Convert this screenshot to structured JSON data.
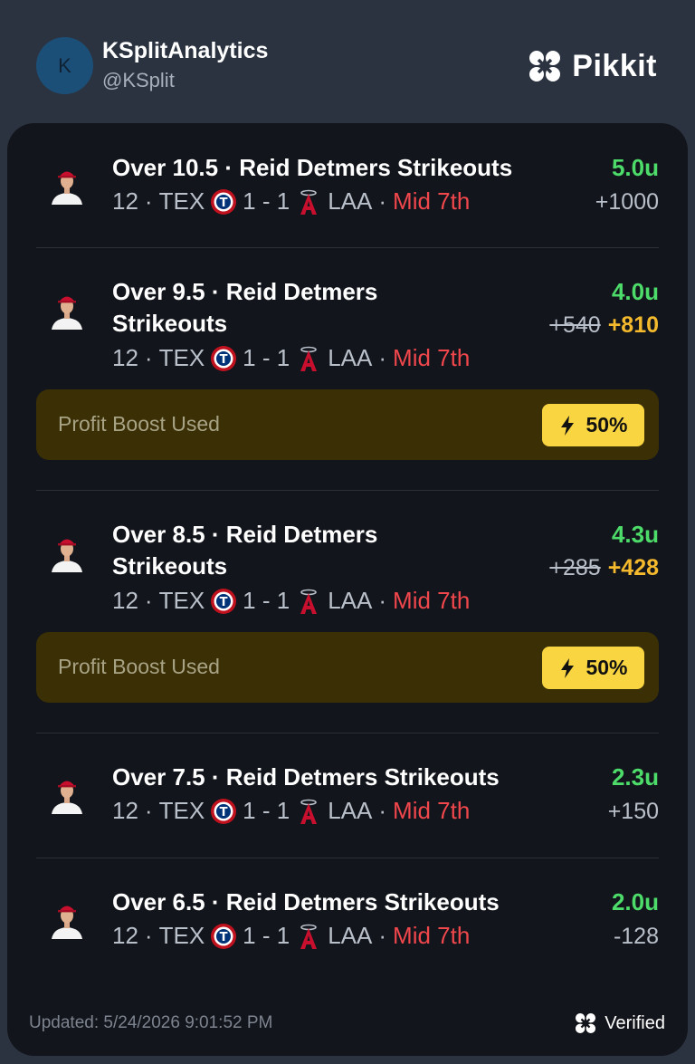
{
  "header": {
    "avatar_letter": "K",
    "display_name": "KSplitAnalytics",
    "handle": "@KSplit",
    "brand_name": "Pikkit"
  },
  "bets": [
    {
      "title": "Over 10.5 · Reid Detmers Strikeouts",
      "inning_num": "12",
      "away_team": "TEX",
      "score": "1 - 1",
      "home_team": "LAA",
      "status": "Mid 7th",
      "units": "5.0u",
      "odds": "+1000"
    },
    {
      "title": "Over 9.5 · Reid Detmers Strikeouts",
      "inning_num": "12",
      "away_team": "TEX",
      "score": "1 - 1",
      "home_team": "LAA",
      "status": "Mid 7th",
      "units": "4.0u",
      "odds_original": "+540",
      "odds_boosted": "+810",
      "boost": {
        "label": "Profit Boost Used",
        "percent": "50%"
      }
    },
    {
      "title": "Over 8.5 · Reid Detmers Strikeouts",
      "inning_num": "12",
      "away_team": "TEX",
      "score": "1 - 1",
      "home_team": "LAA",
      "status": "Mid 7th",
      "units": "4.3u",
      "odds_original": "+285",
      "odds_boosted": "+428",
      "boost": {
        "label": "Profit Boost Used",
        "percent": "50%"
      }
    },
    {
      "title": "Over 7.5 · Reid Detmers Strikeouts",
      "inning_num": "12",
      "away_team": "TEX",
      "score": "1 - 1",
      "home_team": "LAA",
      "status": "Mid 7th",
      "units": "2.3u",
      "odds": "+150"
    },
    {
      "title": "Over 6.5 · Reid Detmers Strikeouts",
      "inning_num": "12",
      "away_team": "TEX",
      "score": "1 - 1",
      "home_team": "LAA",
      "status": "Mid 7th",
      "units": "2.0u",
      "odds": "-128"
    }
  ],
  "footer": {
    "updated": "Updated: 5/24/2026 9:01:52 PM",
    "verified": "Verified"
  },
  "colors": {
    "background": "#2b3340",
    "card": "#12151b",
    "units_green": "#4ddb6a",
    "boosted_odds": "#f4b92d",
    "live_status": "#f0474d",
    "boost_bg": "#3a2f05",
    "boost_badge": "#f9d541"
  },
  "icons": {
    "brand": "clover-logo-icon",
    "player": "player-headshot-icon",
    "away_team_logo": "rangers-logo-icon",
    "home_team_logo": "angels-logo-icon",
    "boost": "lightning-bolt-icon",
    "verified": "clover-verified-icon"
  }
}
